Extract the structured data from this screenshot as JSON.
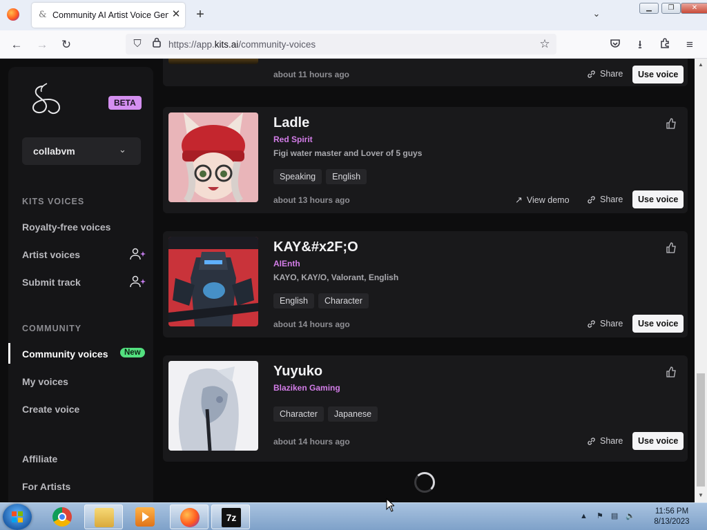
{
  "browser": {
    "tab_title": "Community AI Artist Voice Gen",
    "url_prefix": "https://app.",
    "url_domain": "kits.ai",
    "url_path": "/community-voices"
  },
  "sidebar": {
    "beta": "BETA",
    "account": "collabvm",
    "kits_voices_label": "KITS VOICES",
    "royalty_free": "Royalty-free voices",
    "artist_voices": "Artist voices",
    "submit_track": "Submit track",
    "community_label": "COMMUNITY",
    "community_voices": "Community voices",
    "new_badge": "New",
    "my_voices": "My voices",
    "create_voice": "Create voice",
    "affiliate": "Affiliate",
    "for_artists": "For Artists"
  },
  "cards": [
    {
      "name": "",
      "author": "",
      "description": "",
      "tags": [],
      "time": "about 11 hours ago",
      "share": "Share",
      "use": "Use voice"
    },
    {
      "name": "Ladle",
      "author": "Red Spirit",
      "description": "Figi water master and Lover of 5 guys",
      "tags": [
        "Speaking",
        "English"
      ],
      "time": "about 13 hours ago",
      "demo": "View demo",
      "share": "Share",
      "use": "Use voice"
    },
    {
      "name": "KAY&#x2F;O",
      "author": "AIEnth",
      "description": "KAYO, KAY/O, Valorant, English",
      "tags": [
        "English",
        "Character"
      ],
      "time": "about 14 hours ago",
      "share": "Share",
      "use": "Use voice"
    },
    {
      "name": "Yuyuko",
      "author": "Blaziken Gaming",
      "description": "",
      "tags": [
        "Character",
        "Japanese"
      ],
      "time": "about 14 hours ago",
      "share": "Share",
      "use": "Use voice"
    }
  ],
  "taskbar": {
    "time": "11:56 PM",
    "date": "8/13/2023",
    "sevenzip": "7z"
  },
  "colors": {
    "accent_purple": "#d37de8",
    "beta_bg": "#d48ff0",
    "new_green": "#53e07f"
  }
}
